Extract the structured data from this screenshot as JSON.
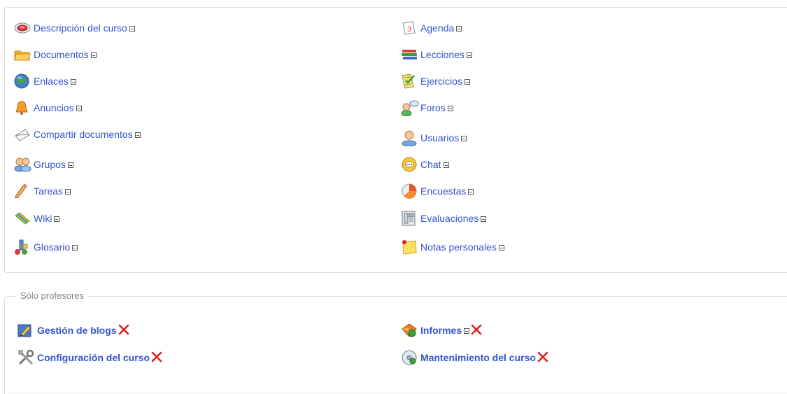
{
  "tools_left": [
    {
      "label": "Descripción del curso",
      "icon": "course-description-icon"
    },
    {
      "label": "Documentos",
      "icon": "folder-icon"
    },
    {
      "label": "Enlaces",
      "icon": "globe-icon"
    },
    {
      "label": "Anuncios",
      "icon": "bell-icon"
    },
    {
      "label": "Compartir documentos",
      "icon": "envelope-icon"
    },
    {
      "label": "Grupos",
      "icon": "group-icon"
    },
    {
      "label": "Tareas",
      "icon": "pencil-icon"
    },
    {
      "label": "Wiki",
      "icon": "wiki-icon"
    },
    {
      "label": "Glosario",
      "icon": "glossary-icon"
    }
  ],
  "tools_right": [
    {
      "label": "Agenda",
      "icon": "calendar-icon"
    },
    {
      "label": "Lecciones",
      "icon": "books-icon"
    },
    {
      "label": "Ejercicios",
      "icon": "exercises-icon"
    },
    {
      "label": "Foros",
      "icon": "forum-icon"
    },
    {
      "label": "Usuarios",
      "icon": "user-icon"
    },
    {
      "label": "Chat",
      "icon": "chat-icon"
    },
    {
      "label": "Encuestas",
      "icon": "survey-icon"
    },
    {
      "label": "Evaluaciones",
      "icon": "gradebook-icon"
    },
    {
      "label": "Notas personales",
      "icon": "notes-icon"
    }
  ],
  "admin_section": {
    "legend": "Sólo profesores",
    "items": [
      {
        "label": "Gestión de blogs",
        "icon": "blog-management-icon",
        "visibility_toggle": false
      },
      {
        "label": "Informes",
        "icon": "reports-icon",
        "visibility_toggle": true
      },
      {
        "label": "Configuración del curso",
        "icon": "settings-icon",
        "visibility_toggle": false
      },
      {
        "label": "Mantenimiento del curso",
        "icon": "maintenance-icon",
        "visibility_toggle": false
      }
    ]
  },
  "colors": {
    "link": "#3355cc",
    "delete": "#e02020",
    "border": "#d9d9d9",
    "legend": "#888888"
  }
}
